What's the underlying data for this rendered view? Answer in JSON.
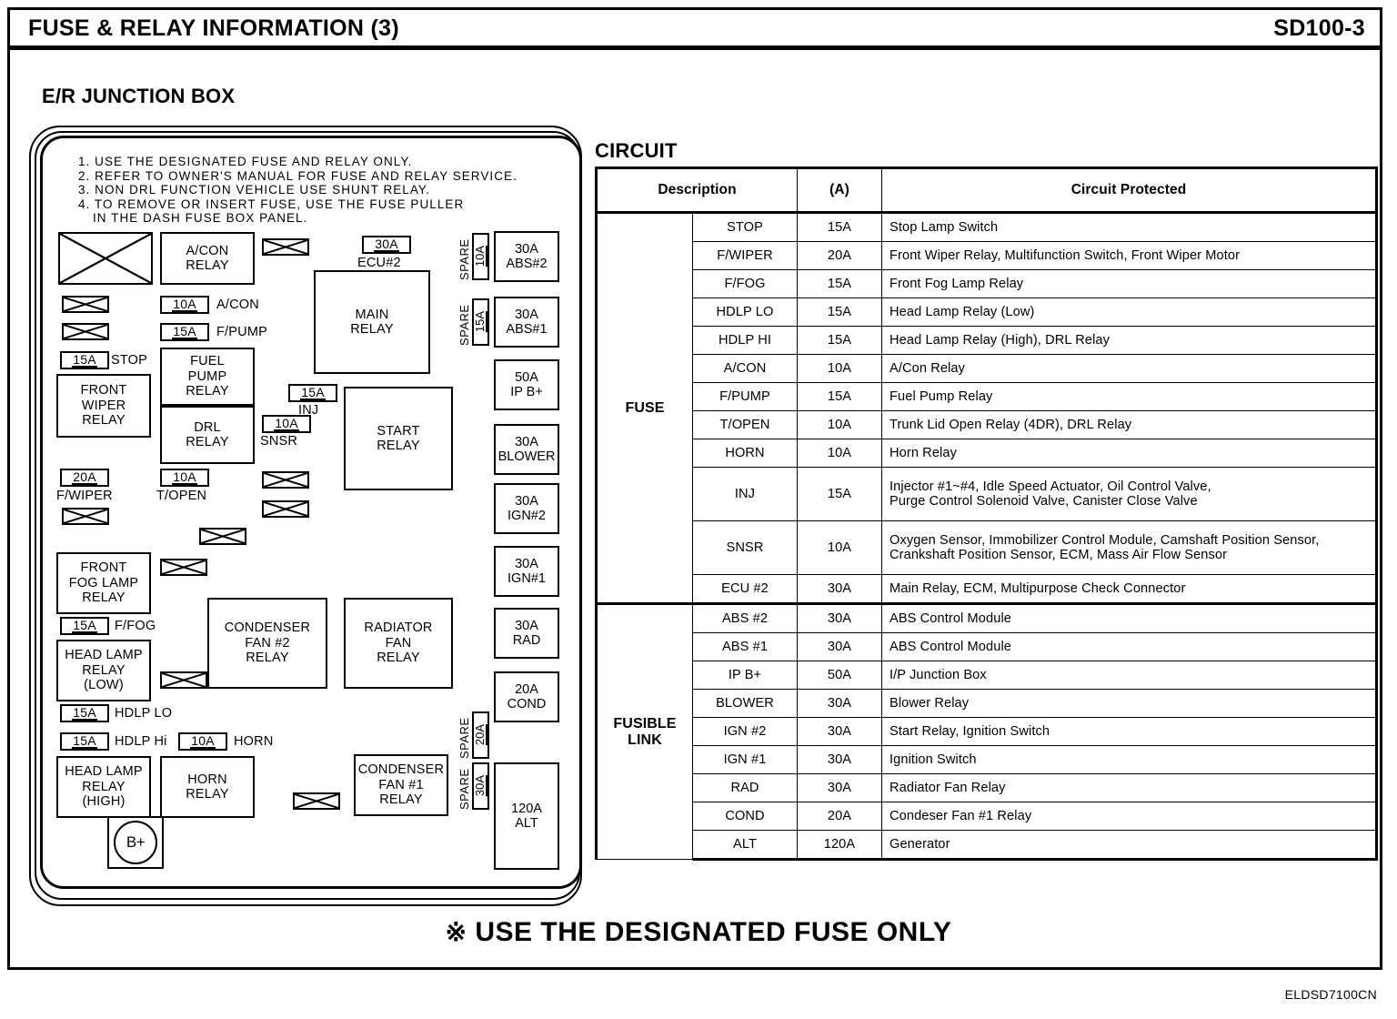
{
  "header": {
    "title": "FUSE & RELAY INFORMATION (3)",
    "page_code": "SD100-3"
  },
  "diagram": {
    "section_title": "E/R JUNCTION BOX",
    "notes": [
      "1. USE THE DESIGNATED FUSE AND RELAY ONLY.",
      "2. REFER TO OWNER'S MANUAL FOR FUSE AND RELAY SERVICE.",
      "3. NON DRL FUNCTION VEHICLE USE SHUNT RELAY.",
      "4. TO REMOVE OR INSERT FUSE, USE THE FUSE PULLER",
      "IN THE DASH FUSE BOX PANEL."
    ],
    "relays": {
      "acon": [
        "A/CON",
        "RELAY"
      ],
      "front_wiper": [
        "FRONT",
        "WIPER",
        "RELAY"
      ],
      "fuel_pump": [
        "FUEL",
        "PUMP",
        "RELAY"
      ],
      "drl": [
        "DRL",
        "RELAY"
      ],
      "main": [
        "MAIN",
        "RELAY"
      ],
      "start": [
        "START",
        "RELAY"
      ],
      "front_fog": [
        "FRONT",
        "FOG LAMP",
        "RELAY"
      ],
      "head_lamp_low": [
        "HEAD LAMP",
        "RELAY",
        "(LOW)"
      ],
      "head_lamp_high": [
        "HEAD LAMP",
        "RELAY",
        "(HIGH)"
      ],
      "horn": [
        "HORN",
        "RELAY"
      ],
      "condenser_fan2": [
        "CONDENSER",
        "FAN #2",
        "RELAY"
      ],
      "radiator_fan": [
        "RADIATOR",
        "FAN",
        "RELAY"
      ],
      "condenser_fan1": [
        "CONDENSER",
        "FAN #1",
        "RELAY"
      ]
    },
    "fuses": [
      {
        "amp": "10A",
        "label": "A/CON"
      },
      {
        "amp": "15A",
        "label": "F/PUMP"
      },
      {
        "amp": "15A",
        "label": "STOP"
      },
      {
        "amp": "20A",
        "label": "F/WIPER"
      },
      {
        "amp": "10A",
        "label": "T/OPEN"
      },
      {
        "amp": "30A",
        "label": "ECU#2"
      },
      {
        "amp": "15A",
        "label": "INJ"
      },
      {
        "amp": "10A",
        "label": "SNSR"
      },
      {
        "amp": "15A",
        "label": "F/FOG"
      },
      {
        "amp": "15A",
        "label": "HDLP LO"
      },
      {
        "amp": "15A",
        "label": "HDLP Hi"
      },
      {
        "amp": "10A",
        "label": "HORN"
      }
    ],
    "fusible_links": [
      {
        "amp": "30A",
        "name": "ABS#2"
      },
      {
        "amp": "30A",
        "name": "ABS#1"
      },
      {
        "amp": "50A",
        "name": "IP B+"
      },
      {
        "amp": "30A",
        "name": "BLOWER"
      },
      {
        "amp": "30A",
        "name": "IGN#2"
      },
      {
        "amp": "30A",
        "name": "IGN#1"
      },
      {
        "amp": "30A",
        "name": "RAD"
      },
      {
        "amp": "20A",
        "name": "COND"
      },
      {
        "amp": "120A",
        "name": "ALT"
      }
    ],
    "spares": [
      {
        "label": "SPARE",
        "amp": "10A"
      },
      {
        "label": "SPARE",
        "amp": "15A"
      },
      {
        "label": "SPARE",
        "amp": "20A"
      },
      {
        "label": "SPARE",
        "amp": "30A"
      }
    ],
    "battery_terminal": "B+"
  },
  "circuit": {
    "title": "CIRCUIT",
    "headers": {
      "description": "Description",
      "amp": "(A)",
      "protected": "Circuit Protected"
    },
    "groups": [
      {
        "name": "FUSE",
        "rows": [
          {
            "name": "STOP",
            "amp": "15A",
            "protected": [
              "Stop Lamp Switch"
            ]
          },
          {
            "name": "F/WIPER",
            "amp": "20A",
            "protected": [
              "Front Wiper Relay, Multifunction Switch, Front Wiper Motor"
            ]
          },
          {
            "name": "F/FOG",
            "amp": "15A",
            "protected": [
              "Front Fog Lamp Relay"
            ]
          },
          {
            "name": "HDLP LO",
            "amp": "15A",
            "protected": [
              "Head Lamp Relay (Low)"
            ]
          },
          {
            "name": "HDLP HI",
            "amp": "15A",
            "protected": [
              "Head Lamp Relay (High), DRL Relay"
            ]
          },
          {
            "name": "A/CON",
            "amp": "10A",
            "protected": [
              "A/Con Relay"
            ]
          },
          {
            "name": "F/PUMP",
            "amp": "15A",
            "protected": [
              "Fuel Pump Relay"
            ]
          },
          {
            "name": "T/OPEN",
            "amp": "10A",
            "protected": [
              "Trunk Lid Open Relay (4DR), DRL Relay"
            ]
          },
          {
            "name": "HORN",
            "amp": "10A",
            "protected": [
              "Horn Relay"
            ]
          },
          {
            "name": "INJ",
            "amp": "15A",
            "protected": [
              "Injector #1~#4, Idle Speed Actuator, Oil Control Valve,",
              "Purge Control Solenoid Valve, Canister Close Valve"
            ]
          },
          {
            "name": "SNSR",
            "amp": "10A",
            "protected": [
              "Oxygen Sensor, Immobilizer Control Module, Camshaft Position Sensor,",
              "Crankshaft Position Sensor, ECM, Mass Air Flow Sensor"
            ]
          },
          {
            "name": "ECU #2",
            "amp": "30A",
            "protected": [
              "Main Relay, ECM, Multipurpose Check Connector"
            ]
          }
        ]
      },
      {
        "name": "FUSIBLE LINK",
        "name_lines": [
          "FUSIBLE",
          "LINK"
        ],
        "rows": [
          {
            "name": "ABS #2",
            "amp": "30A",
            "protected": [
              "ABS Control Module"
            ]
          },
          {
            "name": "ABS #1",
            "amp": "30A",
            "protected": [
              "ABS Control Module"
            ]
          },
          {
            "name": "IP B+",
            "amp": "50A",
            "protected": [
              "I/P Junction Box"
            ]
          },
          {
            "name": "BLOWER",
            "amp": "30A",
            "protected": [
              "Blower Relay"
            ]
          },
          {
            "name": "IGN #2",
            "amp": "30A",
            "protected": [
              "Start Relay, Ignition Switch"
            ]
          },
          {
            "name": "IGN #1",
            "amp": "30A",
            "protected": [
              "Ignition Switch"
            ]
          },
          {
            "name": "RAD",
            "amp": "30A",
            "protected": [
              "Radiator Fan Relay"
            ]
          },
          {
            "name": "COND",
            "amp": "20A",
            "protected": [
              "Condeser Fan #1 Relay"
            ]
          },
          {
            "name": "ALT",
            "amp": "120A",
            "protected": [
              "Generator"
            ]
          }
        ]
      }
    ]
  },
  "footer": {
    "mark": "※",
    "note": "USE THE DESIGNATED FUSE ONLY",
    "doc_id": "ELDSD7100CN"
  }
}
